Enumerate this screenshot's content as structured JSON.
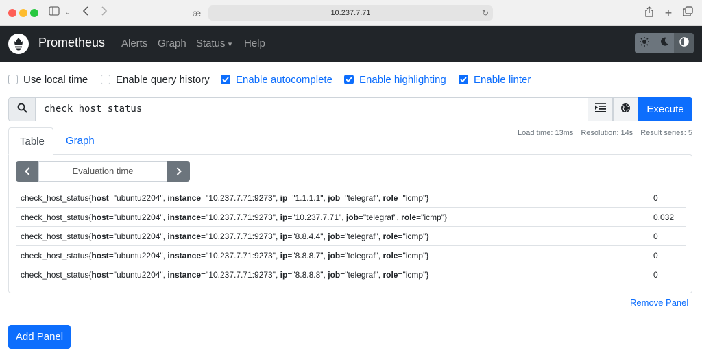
{
  "browser": {
    "url": "10.237.7.71",
    "reader_glyph": "æ",
    "icons": [
      "sidebar-icon",
      "chevron-down-icon",
      "back-icon",
      "forward-icon",
      "reload-icon",
      "share-icon",
      "plus-icon",
      "tabs-icon"
    ]
  },
  "navbar": {
    "brand": "Prometheus",
    "links": [
      "Alerts",
      "Graph",
      "Status",
      "Help"
    ],
    "status_caret": "▾",
    "theme_buttons": [
      "sun-icon",
      "moon-icon",
      "contrast-icon"
    ]
  },
  "options": [
    {
      "label": "Use local time",
      "checked": false
    },
    {
      "label": "Enable query history",
      "checked": false
    },
    {
      "label": "Enable autocomplete",
      "checked": true
    },
    {
      "label": "Enable highlighting",
      "checked": true
    },
    {
      "label": "Enable linter",
      "checked": true
    }
  ],
  "query": {
    "value": "check_host_status",
    "execute_label": "Execute"
  },
  "tabs": [
    "Table",
    "Graph"
  ],
  "active_tab": "Table",
  "stats": {
    "load_time": "Load time: 13ms",
    "resolution": "Resolution: 14s",
    "result_series": "Result series: 5"
  },
  "evaluation_time_placeholder": "Evaluation time",
  "results": [
    {
      "metric": "check_host_status",
      "labels": [
        [
          "host",
          "ubuntu2204"
        ],
        [
          "instance",
          "10.237.7.71:9273"
        ],
        [
          "ip",
          "1.1.1.1"
        ],
        [
          "job",
          "telegraf"
        ],
        [
          "role",
          "icmp"
        ]
      ],
      "value": "0"
    },
    {
      "metric": "check_host_status",
      "labels": [
        [
          "host",
          "ubuntu2204"
        ],
        [
          "instance",
          "10.237.7.71:9273"
        ],
        [
          "ip",
          "10.237.7.71"
        ],
        [
          "job",
          "telegraf"
        ],
        [
          "role",
          "icmp"
        ]
      ],
      "value": "0.032"
    },
    {
      "metric": "check_host_status",
      "labels": [
        [
          "host",
          "ubuntu2204"
        ],
        [
          "instance",
          "10.237.7.71:9273"
        ],
        [
          "ip",
          "8.8.4.4"
        ],
        [
          "job",
          "telegraf"
        ],
        [
          "role",
          "icmp"
        ]
      ],
      "value": "0"
    },
    {
      "metric": "check_host_status",
      "labels": [
        [
          "host",
          "ubuntu2204"
        ],
        [
          "instance",
          "10.237.7.71:9273"
        ],
        [
          "ip",
          "8.8.8.7"
        ],
        [
          "job",
          "telegraf"
        ],
        [
          "role",
          "icmp"
        ]
      ],
      "value": "0"
    },
    {
      "metric": "check_host_status",
      "labels": [
        [
          "host",
          "ubuntu2204"
        ],
        [
          "instance",
          "10.237.7.71:9273"
        ],
        [
          "ip",
          "8.8.8.8"
        ],
        [
          "job",
          "telegraf"
        ],
        [
          "role",
          "icmp"
        ]
      ],
      "value": "0"
    }
  ],
  "remove_panel_label": "Remove Panel",
  "add_panel_label": "Add Panel",
  "colors": {
    "primary": "#0d6efd",
    "navbar": "#212529",
    "secondary": "#6c757d"
  }
}
